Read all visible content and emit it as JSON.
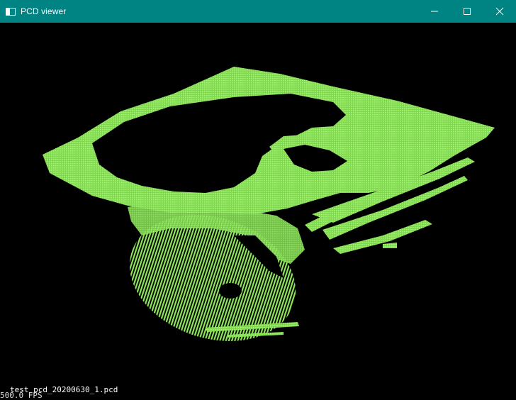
{
  "window": {
    "title": "PCD viewer"
  },
  "icons": {
    "app": "window-app-icon",
    "minimize": "minimize-icon",
    "maximize": "maximize-icon",
    "close": "close-icon"
  },
  "colors": {
    "titlebar": "#008383",
    "background": "#000000",
    "points": "#8ee85a"
  },
  "viewer": {
    "file_label": "test_pcd_20200630_1.pcd",
    "fps_label": "500.0 FPS"
  }
}
